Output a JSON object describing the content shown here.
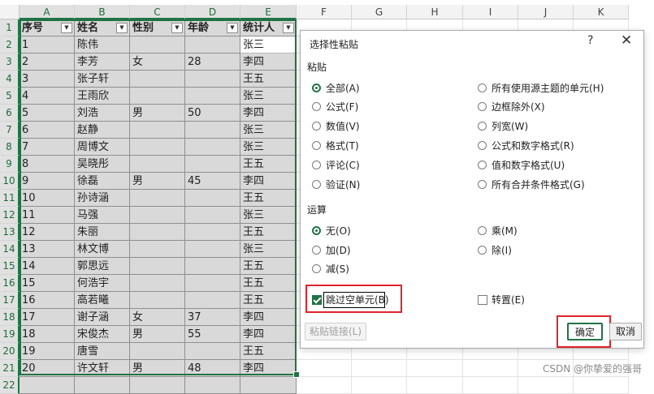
{
  "sheet": {
    "columns": [
      "A",
      "B",
      "C",
      "D",
      "E",
      "F",
      "G",
      "H",
      "I",
      "J",
      "K"
    ],
    "rows": [
      "1",
      "2",
      "3",
      "4",
      "5",
      "6",
      "7",
      "8",
      "9",
      "10",
      "11",
      "12",
      "13",
      "14",
      "15",
      "16",
      "17",
      "18",
      "19",
      "20",
      "21",
      "22"
    ],
    "headers": [
      "序号",
      "姓名",
      "性别",
      "年龄",
      "统计人"
    ],
    "filter_icon": "filter-dropdown-icon",
    "data": [
      [
        "1",
        "陈伟",
        "",
        "",
        "张三"
      ],
      [
        "2",
        "李芳",
        "女",
        "28",
        "李四"
      ],
      [
        "3",
        "张子轩",
        "",
        "",
        "王五"
      ],
      [
        "4",
        "王雨欣",
        "",
        "",
        "张三"
      ],
      [
        "5",
        "刘浩",
        "男",
        "50",
        "李四"
      ],
      [
        "6",
        "赵静",
        "",
        "",
        "张三"
      ],
      [
        "7",
        "周博文",
        "",
        "",
        "张三"
      ],
      [
        "8",
        "吴晓彤",
        "",
        "",
        "王五"
      ],
      [
        "9",
        "徐磊",
        "男",
        "45",
        "李四"
      ],
      [
        "10",
        "孙诗涵",
        "",
        "",
        "王五"
      ],
      [
        "11",
        "马强",
        "",
        "",
        "张三"
      ],
      [
        "12",
        "朱丽",
        "",
        "",
        "王五"
      ],
      [
        "13",
        "林文博",
        "",
        "",
        "张三"
      ],
      [
        "14",
        "郭思远",
        "",
        "",
        "王五"
      ],
      [
        "15",
        "何浩宇",
        "",
        "",
        "王五"
      ],
      [
        "16",
        "高若曦",
        "",
        "",
        "王五"
      ],
      [
        "17",
        "谢子涵",
        "女",
        "37",
        "李四"
      ],
      [
        "18",
        "宋俊杰",
        "男",
        "55",
        "李四"
      ],
      [
        "19",
        "唐雪",
        "",
        "",
        "王五"
      ],
      [
        "20",
        "许文轩",
        "男",
        "48",
        "李四"
      ]
    ]
  },
  "dialog": {
    "title": "选择性粘贴",
    "help": "?",
    "close": "✕",
    "paste_section": "粘贴",
    "paste_left": [
      "全部(A)",
      "公式(F)",
      "数值(V)",
      "格式(T)",
      "评论(C)",
      "验证(N)"
    ],
    "paste_right": [
      "所有使用源主题的单元(H)",
      "边框除外(X)",
      "列宽(W)",
      "公式和数字格式(R)",
      "值和数字格式(U)",
      "所有合并条件格式(G)"
    ],
    "operation_section": "运算",
    "op_left": [
      "无(O)",
      "加(D)",
      "减(S)"
    ],
    "op_right": [
      "乘(M)",
      "除(I)"
    ],
    "skip_blanks": "跳过空单元(B)",
    "transpose": "转置(E)",
    "paste_link": "粘贴链接(L)",
    "ok": "确定",
    "cancel": "取消"
  },
  "watermark": "CSDN @你挚爱的强哥"
}
